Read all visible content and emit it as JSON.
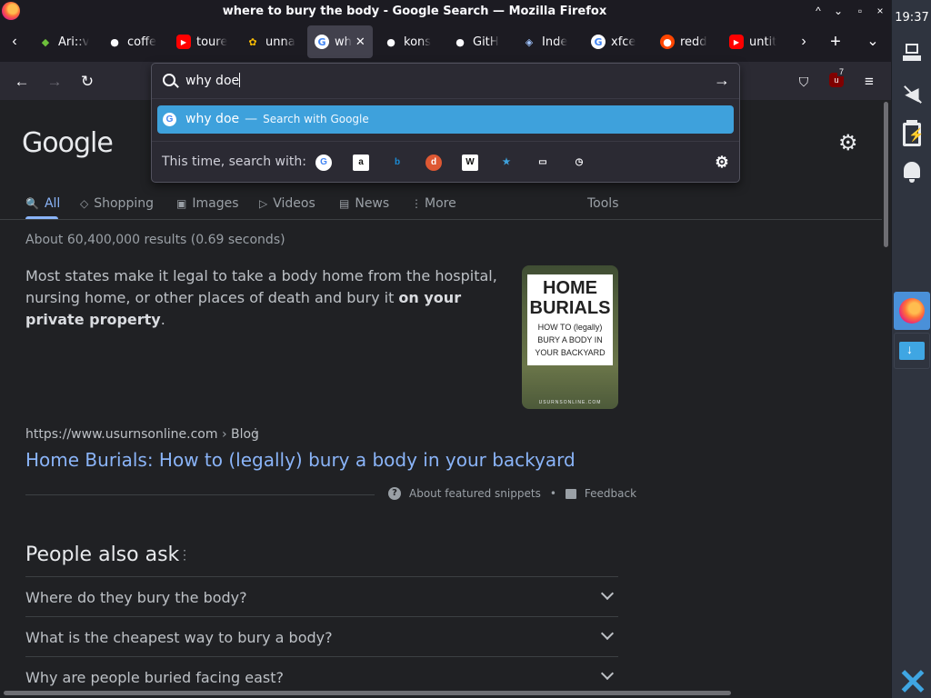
{
  "window": {
    "title": "where to bury the body - Google Search — Mozilla Firefox",
    "controls": [
      "^",
      "⌄",
      "▫",
      "×"
    ]
  },
  "tabs": [
    {
      "label": "Ari::v",
      "icon": "arch-icon",
      "active": false
    },
    {
      "label": "coffe",
      "icon": "github-icon",
      "active": false
    },
    {
      "label": "toure",
      "icon": "youtube-icon",
      "active": false
    },
    {
      "label": "unna",
      "icon": "photos-icon",
      "active": false
    },
    {
      "label": "wh",
      "icon": "google-icon",
      "active": true
    },
    {
      "label": "kons",
      "icon": "github-icon",
      "active": false
    },
    {
      "label": "GitH",
      "icon": "github-icon",
      "active": false
    },
    {
      "label": "Inde",
      "icon": "python-icon",
      "active": false
    },
    {
      "label": "xfce",
      "icon": "google-icon",
      "active": false
    },
    {
      "label": "redd",
      "icon": "reddit-icon",
      "active": false
    },
    {
      "label": "untit",
      "icon": "youtube-icon",
      "active": false
    }
  ],
  "tabbar_controls": {
    "scroll_left": "‹",
    "scroll_right": "›",
    "new_tab": "+",
    "list_all": "⌄"
  },
  "toolbar": {
    "back": "←",
    "forward": "→",
    "reload": "↻",
    "ublock_count": "7",
    "pocket_icon": "pocket-icon",
    "menu_icon": "≡"
  },
  "urlbar": {
    "value": "why doe",
    "go_arrow": "→",
    "suggestion_text": "why doe",
    "suggestion_dash": "—",
    "suggestion_engine": "Search with Google",
    "oneoff_label": "This time, search with:",
    "engines": [
      {
        "name": "google-engine",
        "glyph": "G",
        "color": "#4285f4",
        "bg": "#ffffff"
      },
      {
        "name": "amazon-engine",
        "glyph": "a",
        "color": "#111111",
        "bg": "#ffffff"
      },
      {
        "name": "bing-engine",
        "glyph": "b",
        "color": "#1b8bd6",
        "bg": "transparent"
      },
      {
        "name": "duckduckgo-engine",
        "glyph": "d",
        "color": "#ffffff",
        "bg": "#de5833"
      },
      {
        "name": "wikipedia-engine",
        "glyph": "W",
        "color": "#111111",
        "bg": "#ffffff"
      },
      {
        "name": "bookmarks-engine",
        "glyph": "★",
        "color": "#3ea1dc",
        "bg": "transparent"
      },
      {
        "name": "tabs-engine",
        "glyph": "▭",
        "color": "#fbfbfe",
        "bg": "transparent"
      },
      {
        "name": "history-engine",
        "glyph": "◷",
        "color": "#fbfbfe",
        "bg": "transparent"
      }
    ],
    "settings_glyph": "⚙"
  },
  "google": {
    "logo": "Google",
    "tabs": [
      {
        "label": "All",
        "icon": "🔍"
      },
      {
        "label": "Shopping",
        "icon": "◇"
      },
      {
        "label": "Images",
        "icon": "▣"
      },
      {
        "label": "Videos",
        "icon": "▷"
      },
      {
        "label": "News",
        "icon": "▤"
      },
      {
        "label": "More",
        "icon": "⋮"
      }
    ],
    "tools": "Tools",
    "stats": "About 60,400,000 results (0.69 seconds)",
    "snippet_before": "Most states make it legal to take a body home from the hospital, nursing home, or other places of death and bury it ",
    "snippet_bold": "on your private property",
    "snippet_after": ".",
    "thumbnail": {
      "line1": "HOME",
      "line2": "BURIALS",
      "line3": "HOW TO (legally)",
      "line4": "BURY A BODY IN",
      "line5": "YOUR BACKYARD",
      "footer": "USURNSONLINE.COM"
    },
    "source_url": "https://www.usurnsonline.com",
    "source_sep": "›",
    "source_path": "Blog",
    "result_title": "Home Burials: How to (legally) bury a body in your backyard",
    "about_snippets": "About featured snippets",
    "feedback": "Feedback",
    "paa_title": "People also ask",
    "paa": [
      "Where do they bury the body?",
      "What is the cheapest way to bury a body?",
      "Why are people buried facing east?"
    ]
  },
  "panel": {
    "clock": "19:37"
  }
}
